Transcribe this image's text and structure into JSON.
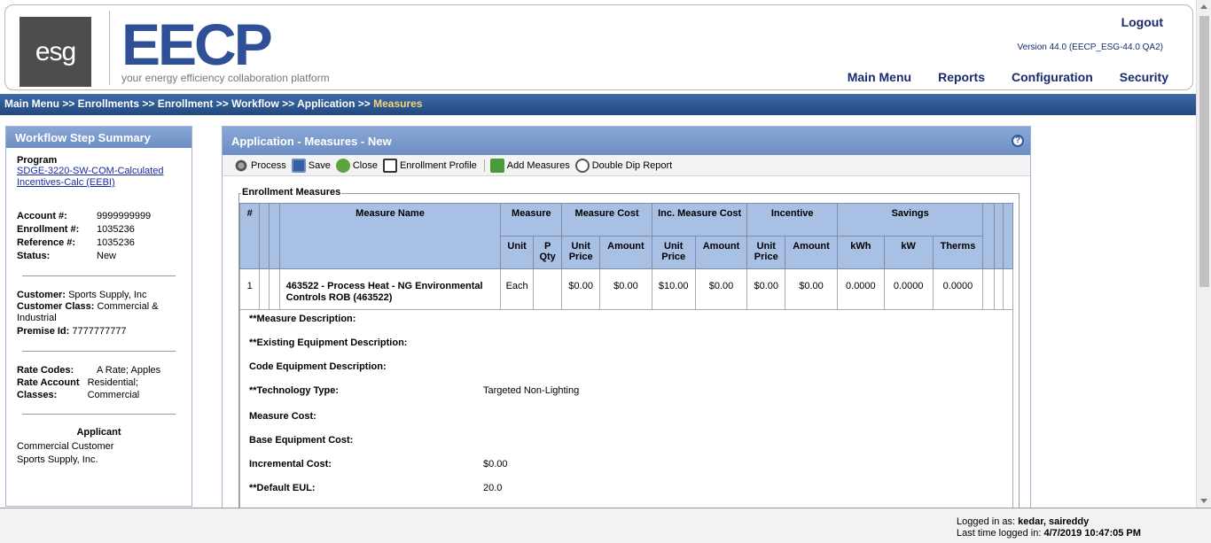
{
  "header": {
    "logo_text": "esg",
    "brand": "EECP",
    "tagline": "your energy efficiency collaboration platform",
    "logout": "Logout",
    "version": "Version 44.0 (EECP_ESG-44.0 QA2)",
    "nav": [
      "Main Menu",
      "Reports",
      "Configuration",
      "Security"
    ]
  },
  "breadcrumb": {
    "trail": "Main Menu >> Enrollments >> Enrollment >> Workflow >> Application >> ",
    "current": "Measures"
  },
  "sidebar": {
    "title": "Workflow Step Summary",
    "program_label": "Program",
    "program_link": "SDGE-3220-SW-COM-Calculated Incentives-Calc (EEBI)",
    "account_label": "Account #:",
    "account": "9999999999",
    "enrollment_label": "Enrollment #:",
    "enrollment": "1035236",
    "reference_label": "Reference #:",
    "reference": "1035236",
    "status_label": "Status:",
    "status": "New",
    "customer_label": "Customer:",
    "customer": "Sports Supply, Inc",
    "customer_class_label": "Customer Class:",
    "customer_class": "Commercial & Industrial",
    "premise_label": "Premise Id:",
    "premise": "7777777777",
    "rate_codes_label": "Rate Codes:",
    "rate_codes": "A Rate; Apples",
    "rate_account_label": "Rate Account Classes:",
    "rate_account": "Residential; Commercial",
    "applicant_title": "Applicant",
    "applicant_line1": "Commercial Customer",
    "applicant_line2": "Sports Supply, Inc."
  },
  "main": {
    "title": "Application - Measures - New",
    "help": "?",
    "toolbar": {
      "process": "Process",
      "save": "Save",
      "close": "Close",
      "profile": "Enrollment Profile",
      "add": "Add Measures",
      "dip": "Double Dip Report"
    },
    "legend": "Enrollment Measures",
    "table": {
      "h_num": "#",
      "h_name": "Measure Name",
      "h_measure": "Measure",
      "h_cost": "Measure Cost",
      "h_inc_cost": "Inc. Measure Cost",
      "h_incentive": "Incentive",
      "h_savings": "Savings",
      "h_unit": "Unit",
      "h_pqty": "P Qty",
      "h_unit_price": "Unit Price",
      "h_amount": "Amount",
      "h_kwh": "kWh",
      "h_kw": "kW",
      "h_therms": "Therms",
      "row": {
        "num": "1",
        "name": "463522 - Process Heat - NG Environmental Controls ROB (463522)",
        "unit": "Each",
        "pqty": "",
        "cost_unit": "$0.00",
        "cost_amount": "$0.00",
        "inc_unit": "$10.00",
        "inc_amount": "$0.00",
        "incentive_unit": "$0.00",
        "incentive_amount": "$0.00",
        "kwh": "0.0000",
        "kw": "0.0000",
        "therms": "0.0000"
      }
    },
    "details": [
      {
        "label": "**Measure Description:",
        "value": ""
      },
      {
        "label": "**Existing Equipment Description:",
        "value": ""
      },
      {
        "label": "Code Equipment Description:",
        "value": ""
      },
      {
        "label": "**Technology Type:",
        "value": "Targeted Non-Lighting"
      },
      {
        "label": "Measure Cost:",
        "value": ""
      },
      {
        "label": "Base Equipment Cost:",
        "value": ""
      },
      {
        "label": "Incremental Cost:",
        "value": "$0.00"
      },
      {
        "label": "**Default EUL:",
        "value": "20.0"
      }
    ]
  },
  "footer": {
    "logged_label": "Logged in as:",
    "user": "kedar, saireddy",
    "last_label": "Last time logged in:",
    "last_time": "4/7/2019 10:47:05 PM"
  }
}
